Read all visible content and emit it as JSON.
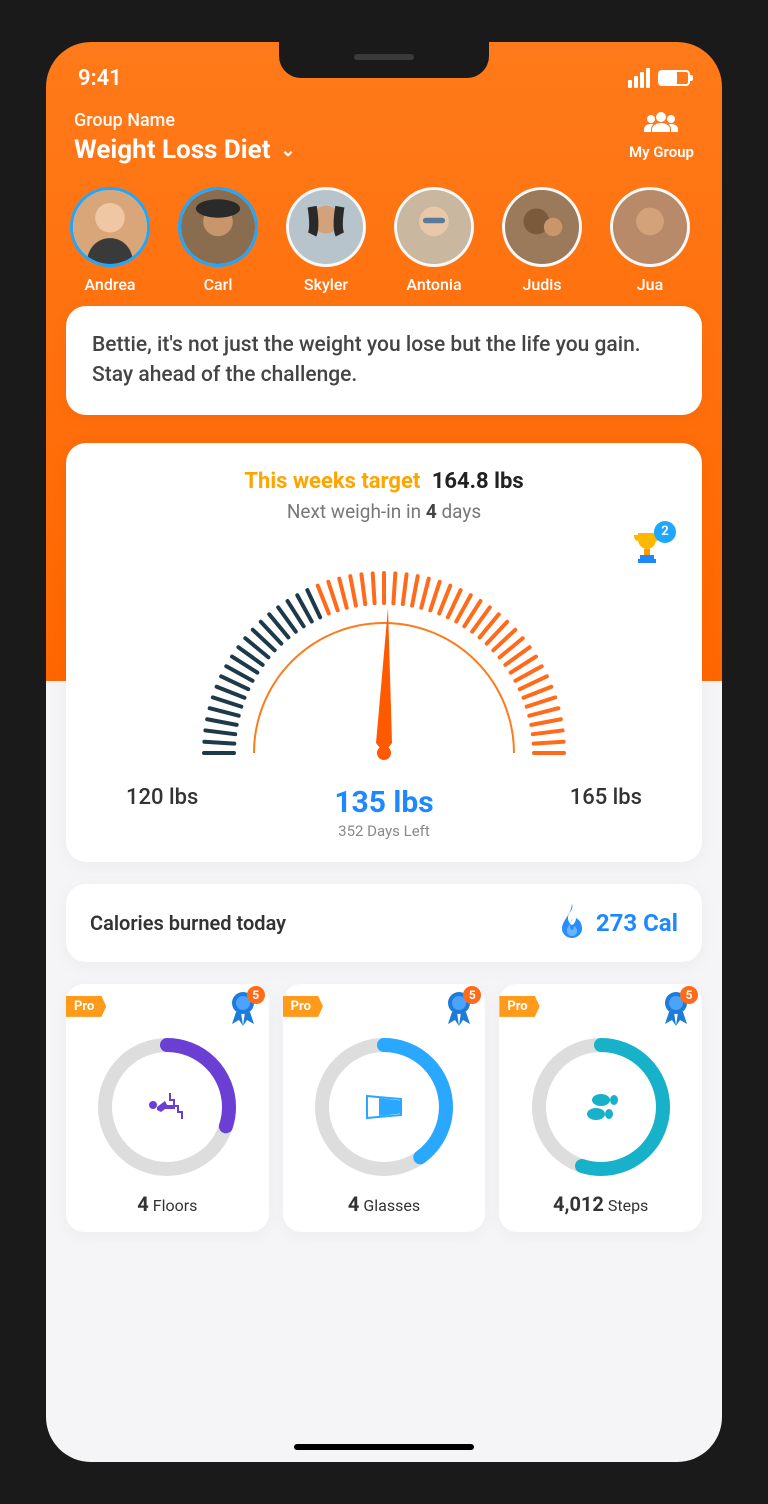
{
  "status": {
    "time": "9:41"
  },
  "header": {
    "label": "Group Name",
    "group_name": "Weight Loss Diet",
    "my_group_label": "My Group"
  },
  "members": [
    {
      "name": "Andrea"
    },
    {
      "name": "Carl"
    },
    {
      "name": "Skyler"
    },
    {
      "name": "Antonia"
    },
    {
      "name": "Judis"
    },
    {
      "name": "Jua"
    }
  ],
  "motivation": "Bettie, it's not just the weight you lose but the life you gain. Stay ahead of the challenge.",
  "target": {
    "label": "This weeks target",
    "value": "164.8 lbs",
    "weighin_prefix": "Next weigh-in in ",
    "weighin_days": "4",
    "weighin_suffix": " days",
    "trophy_badge": "2",
    "gauge_min": "120 lbs",
    "gauge_current": "135 lbs",
    "gauge_max": "165 lbs",
    "days_left": "352 Days Left"
  },
  "calories": {
    "label": "Calories burned today",
    "value": "273 Cal"
  },
  "metrics": {
    "pro_label": "Pro",
    "ribbon_badge": "5",
    "items": [
      {
        "value": "4",
        "unit": "Floors",
        "color": "#6b3fd4",
        "progress": 0.3
      },
      {
        "value": "4",
        "unit": "Glasses",
        "color": "#2aa7ff",
        "progress": 0.4
      },
      {
        "value": "4,012",
        "unit": "Steps",
        "color": "#17b2c9",
        "progress": 0.55
      }
    ]
  },
  "colors": {
    "accent": "#ff6b1a",
    "blue": "#1e88ff"
  }
}
